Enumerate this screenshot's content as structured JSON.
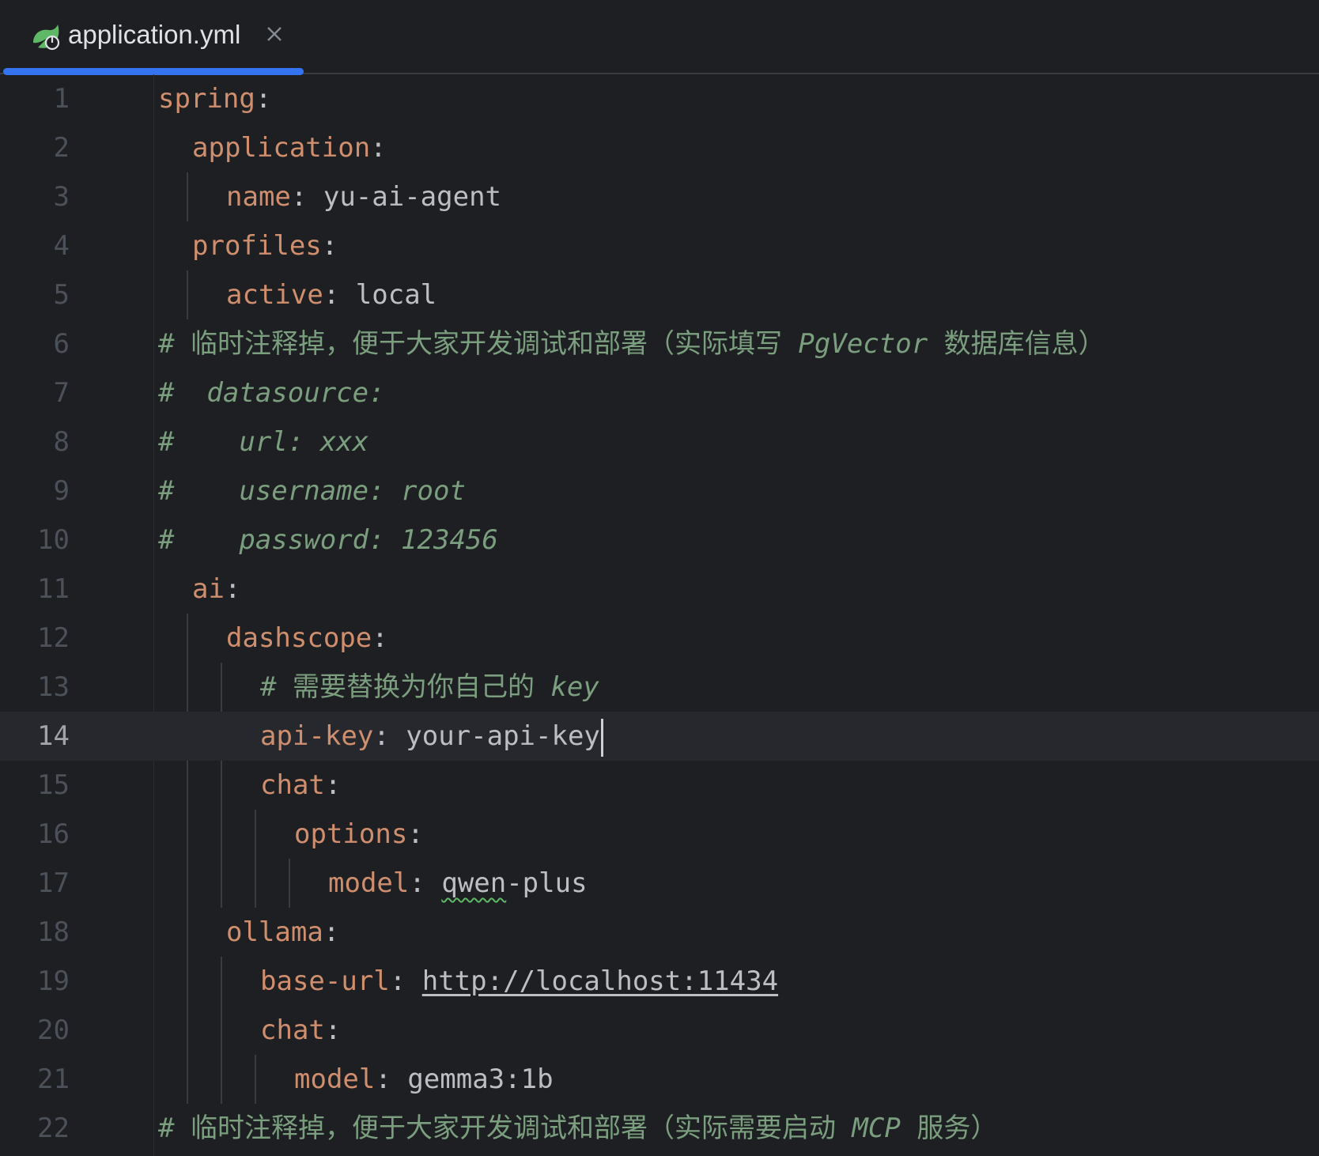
{
  "tab": {
    "filename": "application.yml",
    "icon": "spring-boot-config-icon",
    "close_icon": "close-icon"
  },
  "editor": {
    "current_line": 14,
    "lines": [
      {
        "num": "1",
        "key": "spring",
        "sep": ":"
      },
      {
        "num": "2",
        "key": "application",
        "sep": ":"
      },
      {
        "num": "3",
        "key": "name",
        "sep": ": ",
        "value": "yu-ai-agent"
      },
      {
        "num": "4",
        "key": "profiles",
        "sep": ":"
      },
      {
        "num": "5",
        "key": "active",
        "sep": ": ",
        "value": "local"
      },
      {
        "num": "6",
        "comment_a": "# 临时注释掉，便于大家开发调试和部署（实际填写 ",
        "comment_b": "PgVector",
        "comment_c": " 数据库信息）"
      },
      {
        "num": "7",
        "comment": "#  datasource:"
      },
      {
        "num": "8",
        "comment": "#    url: xxx"
      },
      {
        "num": "9",
        "comment": "#    username: root"
      },
      {
        "num": "10",
        "comment": "#    password: 123456"
      },
      {
        "num": "11",
        "key": "ai",
        "sep": ":"
      },
      {
        "num": "12",
        "key": "dashscope",
        "sep": ":"
      },
      {
        "num": "13",
        "comment_a": "# 需要替换为你自己的 ",
        "comment_b": "key"
      },
      {
        "num": "14",
        "key": "api-key",
        "sep": ": ",
        "value": "your-api-key"
      },
      {
        "num": "15",
        "key": "chat",
        "sep": ":"
      },
      {
        "num": "16",
        "key": "options",
        "sep": ":"
      },
      {
        "num": "17",
        "key": "model",
        "sep": ": ",
        "value_a": "qwen",
        "value_b": "-plus"
      },
      {
        "num": "18",
        "key": "ollama",
        "sep": ":"
      },
      {
        "num": "19",
        "key": "base-url",
        "sep": ": ",
        "value": "http://localhost:11434"
      },
      {
        "num": "20",
        "key": "chat",
        "sep": ":"
      },
      {
        "num": "21",
        "key": "model",
        "sep": ": ",
        "value": "gemma3:1b"
      },
      {
        "num": "22",
        "comment_a": "# 临时注释掉，便于大家开发调试和部署（实际需要启动 ",
        "comment_b": "MCP",
        "comment_c": " 服务）"
      }
    ]
  },
  "colors": {
    "background": "#1e1f22",
    "key": "#cf8e6d",
    "value": "#bcbec4",
    "comment": "#7a9e7e",
    "line_number": "#4b5059",
    "tab_accent": "#3574f0"
  }
}
